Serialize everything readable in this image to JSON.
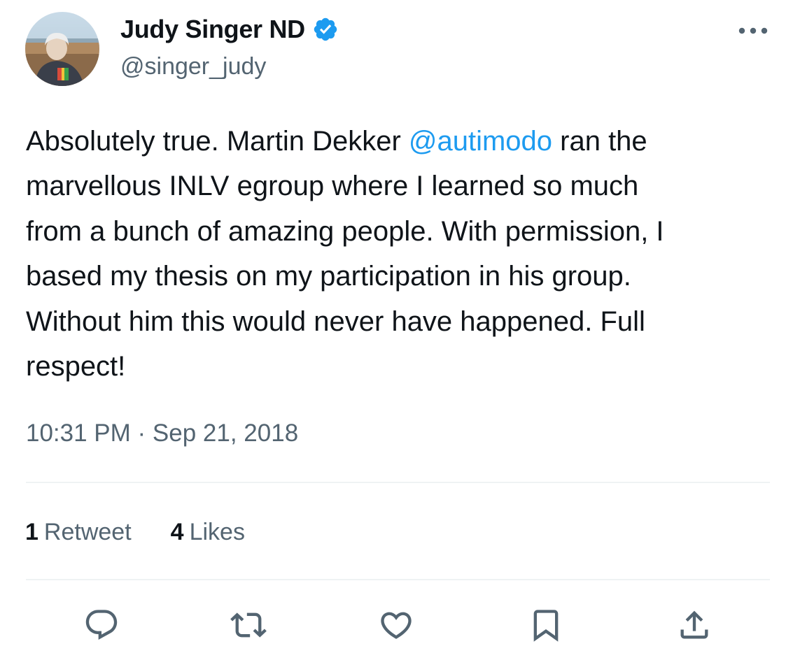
{
  "author": {
    "display_name": "Judy Singer ND",
    "handle": "@singer_judy",
    "verified_icon": "verified-badge-icon",
    "avatar": "profile-photo"
  },
  "header": {
    "more_icon": "more-options-icon"
  },
  "tweet": {
    "lines": [
      {
        "before": "Absolutely true. Martin Dekker ",
        "mention": "@autimodo",
        "after": " ran the"
      },
      {
        "text": "marvellous INLV egroup where I learned so much"
      },
      {
        "text": "from a bunch of amazing people. With permission, I"
      },
      {
        "text": "based my thesis on my participation in his group."
      },
      {
        "text": "Without him this would never have happened. Full"
      },
      {
        "text": "respect!"
      }
    ],
    "timestamp": "10:31 PM · Sep 21, 2018"
  },
  "stats": {
    "retweets": {
      "count": "1",
      "label": "Retweet"
    },
    "likes": {
      "count": "4",
      "label": "Likes"
    }
  },
  "actions": {
    "reply": "reply-icon",
    "retweet": "retweet-icon",
    "like": "like-icon",
    "bookmark": "bookmark-icon",
    "share": "share-icon"
  },
  "colors": {
    "text_primary": "#0f1419",
    "text_secondary": "#536471",
    "mention": "#1d9bf0",
    "verified": "#1d9bf0",
    "divider": "#eff3f4"
  }
}
